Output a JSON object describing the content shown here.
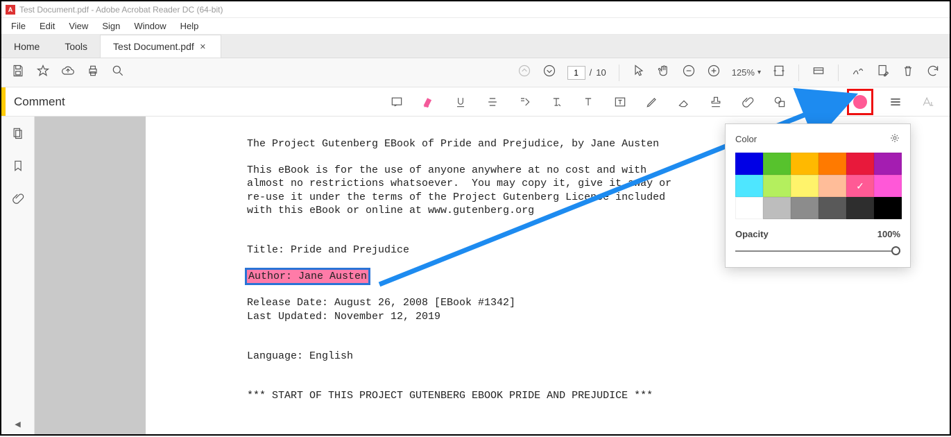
{
  "window": {
    "title": "Test Document.pdf - Adobe Acrobat Reader DC (64-bit)"
  },
  "menu": [
    "File",
    "Edit",
    "View",
    "Sign",
    "Window",
    "Help"
  ],
  "tabs": {
    "home": "Home",
    "tools": "Tools",
    "active": "Test Document.pdf"
  },
  "page_nav": {
    "current": "1",
    "sep": "/",
    "total": "10"
  },
  "zoom": {
    "value": "125%"
  },
  "comment_bar": {
    "label": "Comment"
  },
  "popover": {
    "color_label": "Color",
    "opacity_label": "Opacity",
    "opacity_value": "100%",
    "selected_color": "#ff5a95",
    "colors_row1": [
      "#0000e5",
      "#57c22d",
      "#ffb900",
      "#ff7a00",
      "#e8193b",
      "#a41db1"
    ],
    "colors_row2": [
      "#4ee6ff",
      "#b4ef5e",
      "#fff36b",
      "#ffbd99",
      "#ff5a95",
      "#ff58d8"
    ],
    "colors_row3": [
      "#ffffff",
      "#bdbdbd",
      "#8c8c8c",
      "#595959",
      "#2e2e2e",
      "#000000"
    ]
  },
  "document": {
    "l1": "The Project Gutenberg EBook of Pride and Prejudice, by Jane Austen",
    "l2": "This eBook is for the use of anyone anywhere at no cost and with",
    "l3": "almost no restrictions whatsoever.  You may copy it, give it away or",
    "l4": "re-use it under the terms of the Project Gutenberg License included",
    "l5": "with this eBook or online at www.gutenberg.org",
    "l6": "Title: Pride and Prejudice",
    "l7": "Author: Jane Austen",
    "l8": "Release Date: August 26, 2008 [EBook #1342]",
    "l9": "Last Updated: November 12, 2019",
    "l10": "Language: English",
    "l11": "*** START OF THIS PROJECT GUTENBERG EBOOK PRIDE AND PREJUDICE ***"
  }
}
